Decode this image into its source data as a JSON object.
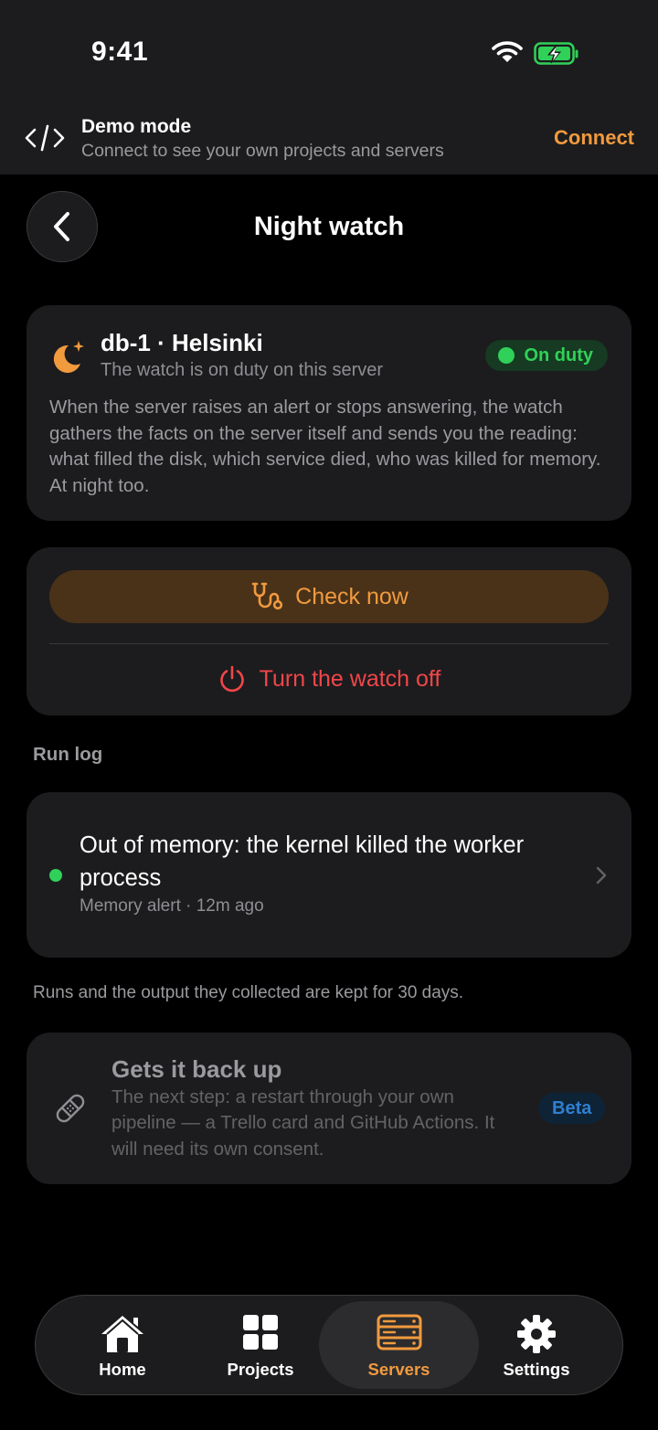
{
  "status_bar": {
    "time": "9:41"
  },
  "demo_banner": {
    "title": "Demo mode",
    "subtitle": "Connect to see your own projects and servers",
    "connect_label": "Connect"
  },
  "header": {
    "title": "Night watch"
  },
  "server_card": {
    "name": "db-1 · Helsinki",
    "subtitle": "The watch is on duty on this server",
    "badge": "On duty",
    "description": "When the server raises an alert or stops answering, the watch gathers the facts on the server itself and sends you the reading: what filled the disk, which service died, who was killed for memory. At night too."
  },
  "actions": {
    "check_now": "Check now",
    "turn_off": "Turn the watch off"
  },
  "run_log": {
    "label": "Run log",
    "entries": [
      {
        "title": "Out of memory: the kernel killed the worker process",
        "meta": "Memory alert · 12m ago"
      }
    ],
    "footnote": "Runs and the output they collected are kept for 30 days."
  },
  "recovery": {
    "title": "Gets it back up",
    "description": "The next step: a restart through your own pipeline — a Trello card and GitHub Actions. It will need its own consent.",
    "badge": "Beta"
  },
  "tabbar": {
    "items": [
      {
        "label": "Home",
        "icon": "home-icon"
      },
      {
        "label": "Projects",
        "icon": "grid-icon"
      },
      {
        "label": "Servers",
        "icon": "server-icon",
        "active": true
      },
      {
        "label": "Settings",
        "icon": "gear-icon"
      }
    ]
  },
  "colors": {
    "accent": "#f19a3e",
    "success": "#30d158",
    "danger": "#f0464a",
    "beta": "#2f7fd0"
  }
}
